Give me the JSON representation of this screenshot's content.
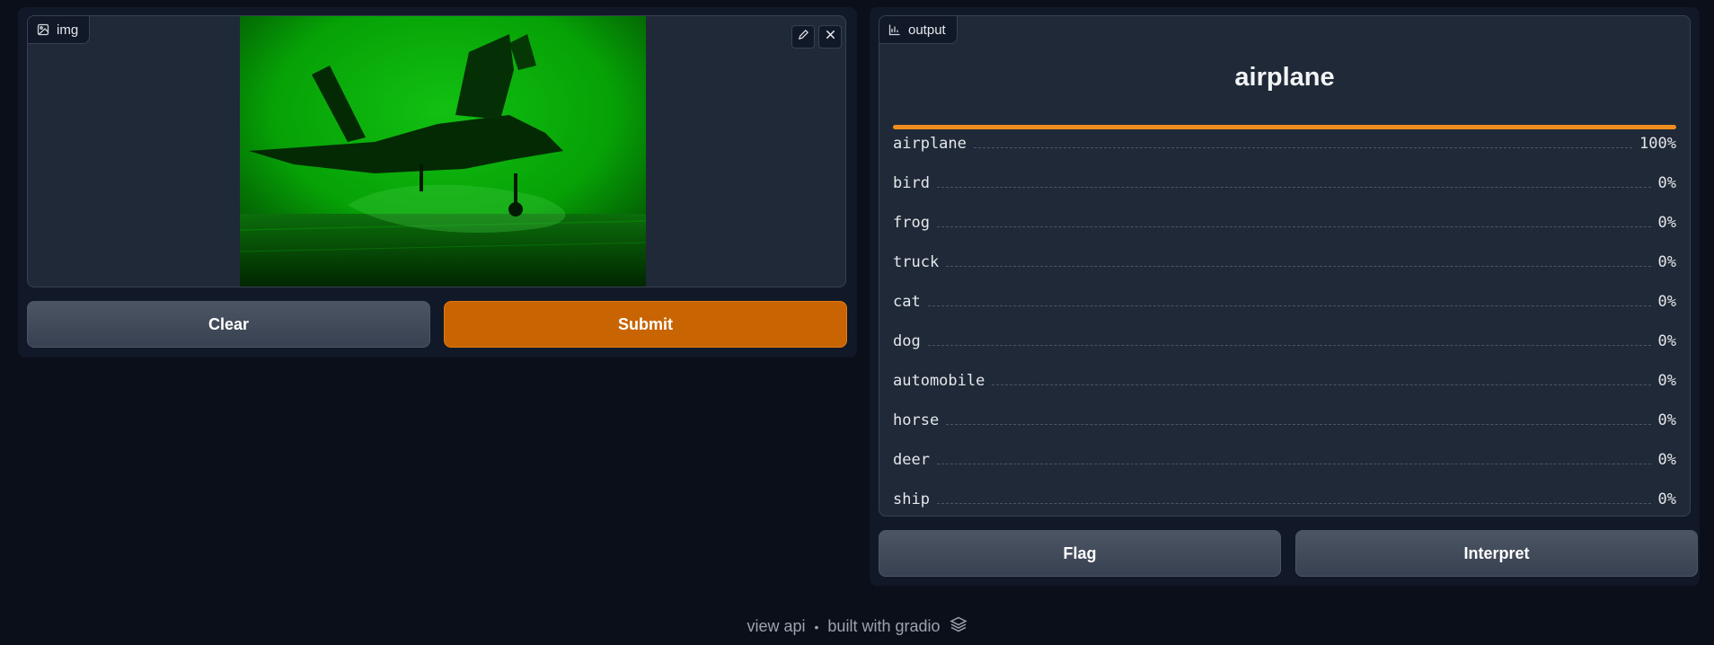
{
  "input": {
    "label": "img",
    "clear_label": "Clear",
    "submit_label": "Submit"
  },
  "output": {
    "label": "output",
    "predicted_label": "airplane",
    "top_confidence": 1.0,
    "confidences": [
      {
        "label": "airplane",
        "pct": "100%"
      },
      {
        "label": "bird",
        "pct": "0%"
      },
      {
        "label": "frog",
        "pct": "0%"
      },
      {
        "label": "truck",
        "pct": "0%"
      },
      {
        "label": "cat",
        "pct": "0%"
      },
      {
        "label": "dog",
        "pct": "0%"
      },
      {
        "label": "automobile",
        "pct": "0%"
      },
      {
        "label": "horse",
        "pct": "0%"
      },
      {
        "label": "deer",
        "pct": "0%"
      },
      {
        "label": "ship",
        "pct": "0%"
      }
    ],
    "flag_label": "Flag",
    "interpret_label": "Interpret"
  },
  "footer": {
    "view_api": "view api",
    "separator": "•",
    "built_with": "built with gradio"
  },
  "colors": {
    "accent": "#f08c1e",
    "primary_button": "#c96402",
    "background": "#0b0f19",
    "panel": "#111827"
  },
  "icons": {
    "image_label": "image-icon",
    "output_label": "bar-chart-icon",
    "edit": "pencil-icon",
    "close": "close-icon",
    "footer_logo": "gradio-logo-icon"
  }
}
